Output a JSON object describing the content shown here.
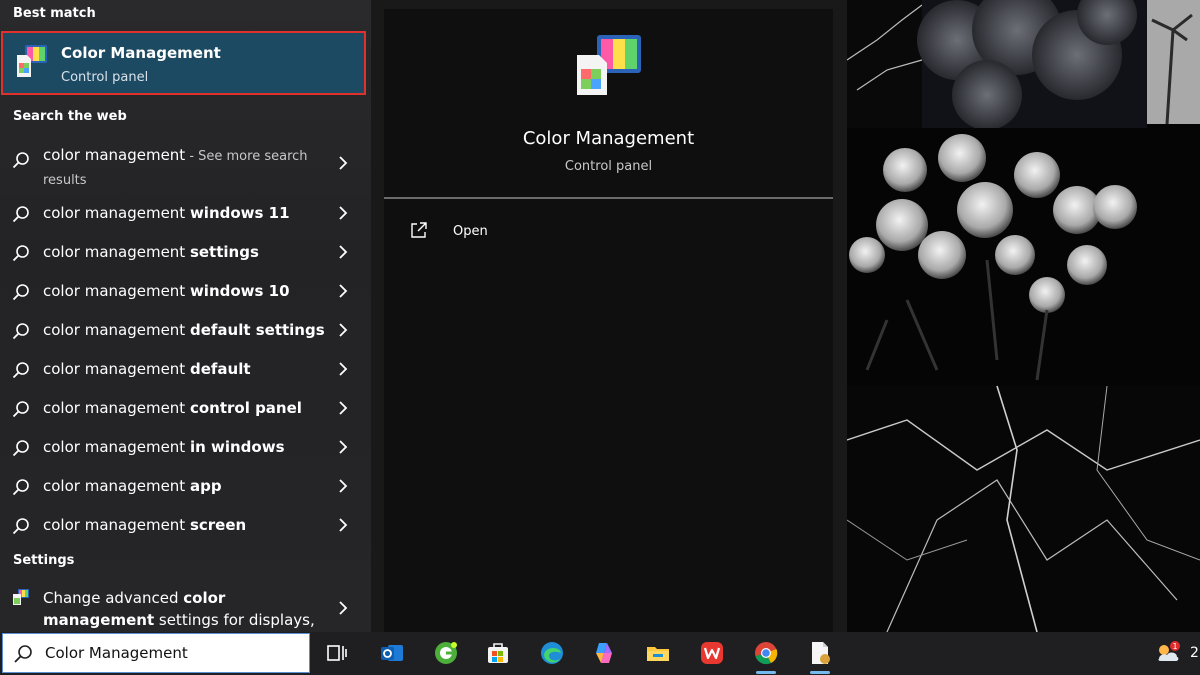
{
  "search_panel": {
    "best_match_header": "Best match",
    "best_match": {
      "title": "Color Management",
      "subtitle": "Control panel"
    },
    "web_header": "Search the web",
    "web_results": [
      {
        "prefix": "color management",
        "bold": "",
        "suffix": " - See more search",
        "line2": "results"
      },
      {
        "prefix": "color management ",
        "bold": "windows 11"
      },
      {
        "prefix": "color management ",
        "bold": "settings"
      },
      {
        "prefix": "color management ",
        "bold": "windows 10"
      },
      {
        "prefix": "color management ",
        "bold": "default settings"
      },
      {
        "prefix": "color management ",
        "bold": "default"
      },
      {
        "prefix": "color management ",
        "bold": "control panel"
      },
      {
        "prefix": "color management ",
        "bold": "in windows"
      },
      {
        "prefix": "color management ",
        "bold": "app"
      },
      {
        "prefix": "color management ",
        "bold": "screen"
      }
    ],
    "settings_header": "Settings",
    "settings_result": {
      "part1": "Change advanced ",
      "bold1": "color",
      "bold2": "management",
      "part2": " settings for displays,"
    }
  },
  "preview": {
    "title": "Color Management",
    "subtitle": "Control panel",
    "open_label": "Open"
  },
  "taskbar": {
    "search_value": "Color Management",
    "icons": [
      "task-view-icon",
      "outlook-icon",
      "browser-g-icon",
      "microsoft-store-icon",
      "edge-icon",
      "copilot-icon",
      "file-explorer-icon",
      "wps-office-icon",
      "chrome-icon",
      "document-app-icon"
    ],
    "tray_badge": "1",
    "tray_text": "2"
  },
  "colors": {
    "best_match_bg": "#1d4a63",
    "highlight_border": "#e0312d",
    "taskbar_bg": "#1f1f22",
    "active_indicator": "#76b9ed"
  }
}
